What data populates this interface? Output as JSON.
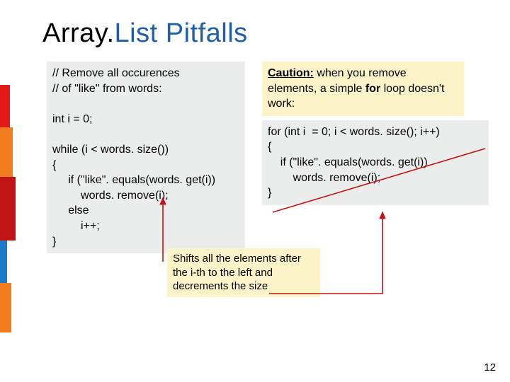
{
  "title_prefix": "Array.",
  "title_mid": "List",
  "title_suffix": " Pitfalls",
  "left_code": "// Remove all occurences\n// of \"like\" from words:\n\nint i = 0;\n\nwhile (i < words. size())\n{\n     if (\"like\". equals(words. get(i))\n         words. remove(i);\n     else\n         i++;\n}",
  "caution_label": "Caution:",
  "caution_text": " when you remove elements, a simple ",
  "caution_bold": "for",
  "caution_tail": " loop doesn't work:",
  "right_code": "for (int i  = 0; i < words. size(); i++)\n{\n    if (\"like\". equals(words. get(i))\n        words. remove(i);\n}",
  "note": "Shifts all the elements after the i-th to the left and decrements the size",
  "page_number": "12",
  "colors": {
    "accent": "#1e5fa8",
    "arrow": "#c01414",
    "strike": "#c01414"
  }
}
